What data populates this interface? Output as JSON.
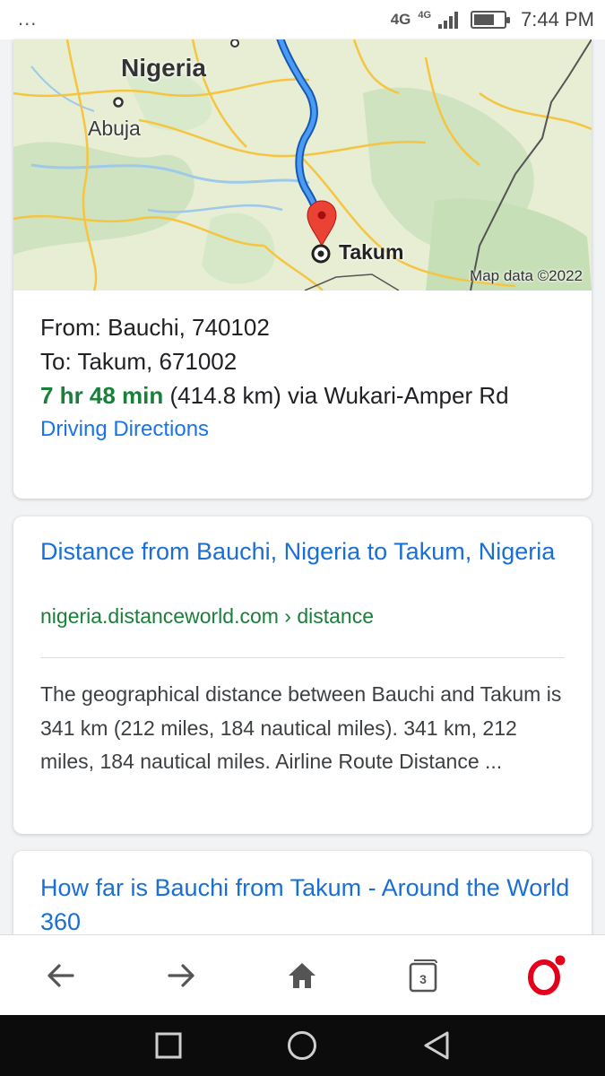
{
  "status_bar": {
    "menu_dots": "...",
    "network_primary": "4G",
    "network_secondary": "4G",
    "battery_level_percent": 70,
    "time": "7:44 PM"
  },
  "map": {
    "country_label": "Nigeria",
    "city_label": "Abuja",
    "destination_label": "Takum",
    "attribution": "Map data ©2022",
    "route_color": "#1a73e8",
    "pin_color": "#ea4335"
  },
  "directions": {
    "from": "From: Bauchi, 740102",
    "to": "To: Takum, 671002",
    "duration": "7 hr 48 min",
    "distance_via": " (414.8 km) via Wukari-Amper Rd",
    "link": "Driving Directions"
  },
  "results": [
    {
      "title": "Distance from Bauchi, Nigeria to Takum, Nigeria",
      "url": "nigeria.distanceworld.com › distance",
      "snippet": "The geographical distance between Bauchi and Takum is 341 km (212 miles, 184 nautical miles). 341 km, 212 miles, 184 nautical miles. Airline Route Distance ..."
    },
    {
      "title": "How far is Bauchi from Takum - Around the World 360"
    }
  ],
  "browser_bar": {
    "back_icon": "arrow-left-icon",
    "forward_icon": "arrow-right-icon",
    "home_icon": "home-icon",
    "tabs_count": "3",
    "menu_icon": "opera-logo-icon",
    "brand_color": "#e3001b"
  },
  "nav_bar": {
    "recents_icon": "square-icon",
    "home_icon": "circle-icon",
    "back_icon": "triangle-back-icon"
  }
}
